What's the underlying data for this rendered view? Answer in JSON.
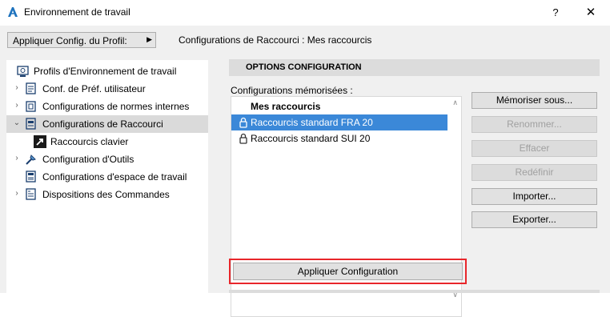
{
  "window": {
    "title": "Environnement de travail",
    "help_label": "?",
    "close_label": "✕"
  },
  "toolbar": {
    "profile_button_label": "Appliquer Config. du Profil:",
    "profile_button_arrow": "▶",
    "config_header": "Configurations de Raccourci : Mes raccourcis"
  },
  "tree": {
    "items": [
      {
        "label": "Profils d'Environnement de travail",
        "expander": ""
      },
      {
        "label": "Conf. de Préf. utilisateur",
        "expander": "›"
      },
      {
        "label": "Configurations de normes internes",
        "expander": "›"
      },
      {
        "label": "Configurations de Raccourci",
        "expander": "⌄"
      },
      {
        "label": "Raccourcis clavier",
        "expander": ""
      },
      {
        "label": "Configuration d'Outils",
        "expander": "›"
      },
      {
        "label": "Configurations d'espace de travail",
        "expander": ""
      },
      {
        "label": "Dispositions des Commandes",
        "expander": "›"
      }
    ],
    "selected_index": 3
  },
  "options": {
    "header": "OPTIONS CONFIGURATION",
    "memorized_label": "Configurations mémorisées :",
    "list_items": [
      {
        "label": "Mes raccourcis",
        "locked": false
      },
      {
        "label": "Raccourcis standard FRA 20",
        "locked": true
      },
      {
        "label": "Raccourcis standard SUI 20",
        "locked": true
      }
    ],
    "selected_index": 1,
    "scroll_up": "∧",
    "scroll_down": "∨",
    "buttons": {
      "memoriser": "Mémoriser sous...",
      "renommer": "Renommer...",
      "effacer": "Effacer",
      "redefinir": "Redéfinir",
      "importer": "Importer...",
      "exporter": "Exporter..."
    },
    "apply_label": "Appliquer Configuration"
  },
  "colors": {
    "selection_blue": "#3b88d8",
    "highlight_red": "#e8262b",
    "panel_bg": "#f0f0f0"
  }
}
